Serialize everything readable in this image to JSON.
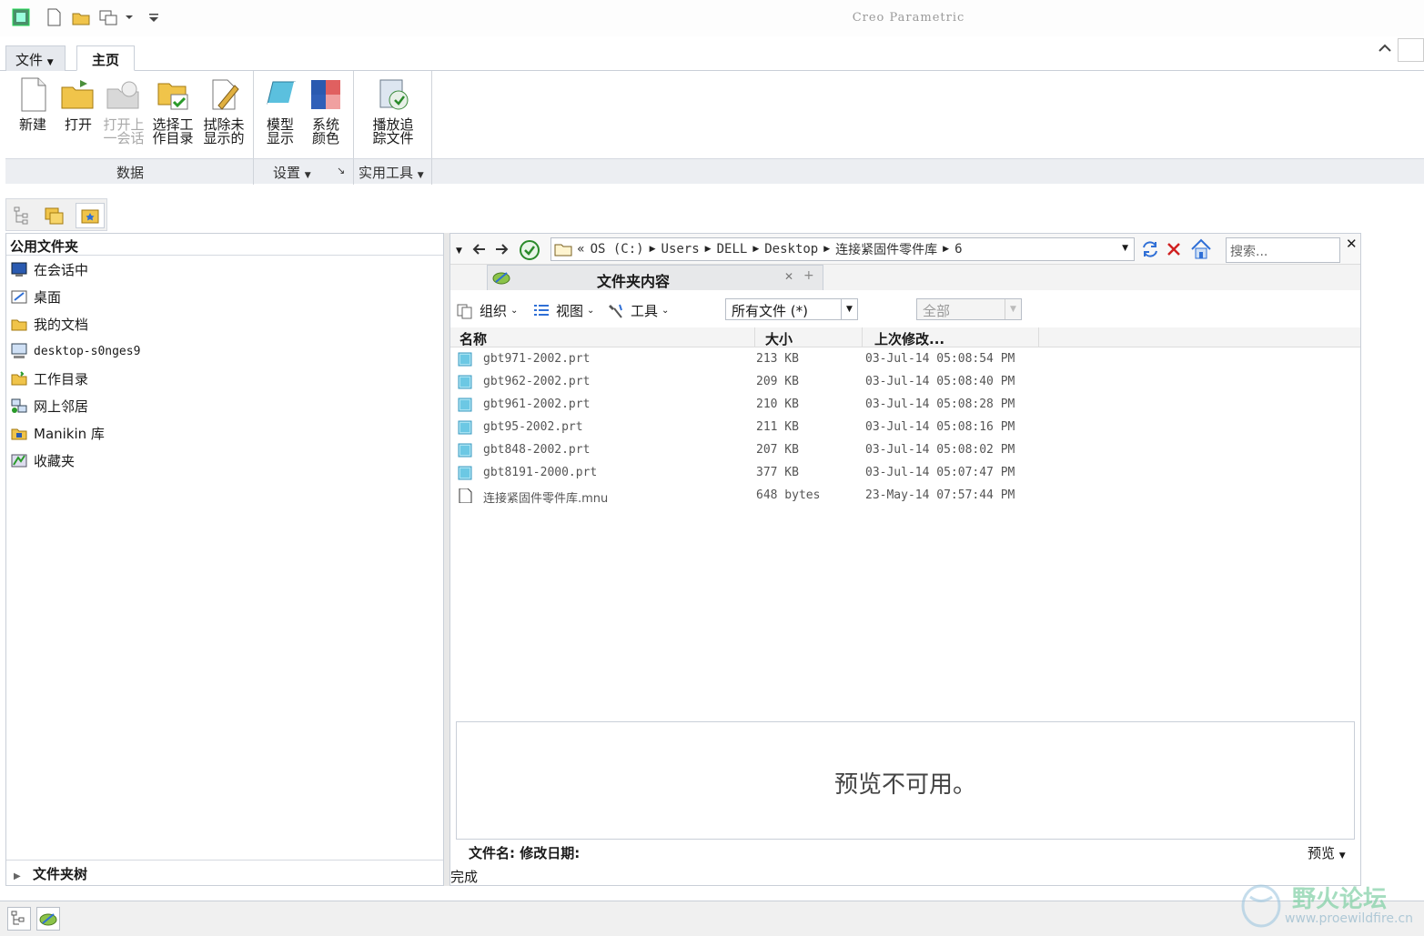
{
  "app": {
    "title": "Creo Parametric"
  },
  "ribbon": {
    "tabs": [
      {
        "label": "文件"
      },
      {
        "label": "主页"
      }
    ],
    "buttons": [
      {
        "label": "新建",
        "enabled": true,
        "icon": "new-file-icon"
      },
      {
        "label": "打开",
        "enabled": true,
        "icon": "open-folder-icon"
      },
      {
        "label1": "打开上",
        "label2": "一会话",
        "enabled": false,
        "icon": "open-last-session-icon"
      },
      {
        "label1": "选择工",
        "label2": "作目录",
        "enabled": true,
        "icon": "select-working-directory-icon"
      },
      {
        "label1": "拭除未",
        "label2": "显示的",
        "enabled": true,
        "icon": "erase-not-displayed-icon"
      },
      {
        "label1": "模型",
        "label2": "显示",
        "enabled": true,
        "icon": "model-display-icon"
      },
      {
        "label1": "系统",
        "label2": "颜色",
        "enabled": true,
        "icon": "system-colors-icon"
      },
      {
        "label1": "播放追",
        "label2": "踪文件",
        "enabled": true,
        "icon": "play-trail-file-icon"
      }
    ],
    "groups": [
      {
        "label": "数据"
      },
      {
        "label": "设置"
      },
      {
        "label": "实用工具"
      }
    ]
  },
  "left_panel": {
    "header": "公用文件夹",
    "items": [
      {
        "label": "在会话中",
        "icon": "in-session-icon"
      },
      {
        "label": "桌面",
        "icon": "desktop-icon"
      },
      {
        "label": "我的文档",
        "icon": "my-documents-icon"
      },
      {
        "label": "desktop-s0nges9",
        "icon": "computer-icon"
      },
      {
        "label": "工作目录",
        "icon": "working-directory-icon"
      },
      {
        "label": "网上邻居",
        "icon": "network-icon"
      },
      {
        "label": "Manikin 库",
        "icon": "manikin-library-icon"
      },
      {
        "label": "收藏夹",
        "icon": "favorites-icon"
      }
    ],
    "footer": "文件夹树"
  },
  "address": {
    "crumbs": [
      "OS (C:)",
      "Users",
      "DELL",
      "Desktop",
      "连接紧固件零件库",
      "6"
    ],
    "prefix": "«",
    "search_placeholder": "搜索..."
  },
  "content": {
    "tab_label": "文件夹内容",
    "toolbar": {
      "organize": "组织",
      "view": "视图",
      "tools": "工具",
      "filter": "所有文件 (*)",
      "scope": "全部"
    },
    "columns": {
      "name": "名称",
      "size": "大小",
      "modified": "上次修改..."
    },
    "files": [
      {
        "name": "gbt971-2002.prt",
        "size": "213 KB",
        "modified": "03-Jul-14 05:08:54 PM",
        "type": "part"
      },
      {
        "name": "gbt962-2002.prt",
        "size": "209 KB",
        "modified": "03-Jul-14 05:08:40 PM",
        "type": "part"
      },
      {
        "name": "gbt961-2002.prt",
        "size": "210 KB",
        "modified": "03-Jul-14 05:08:28 PM",
        "type": "part"
      },
      {
        "name": "gbt95-2002.prt",
        "size": "211 KB",
        "modified": "03-Jul-14 05:08:16 PM",
        "type": "part"
      },
      {
        "name": "gbt848-2002.prt",
        "size": "207 KB",
        "modified": "03-Jul-14 05:08:02 PM",
        "type": "part"
      },
      {
        "name": "gbt8191-2000.prt",
        "size": "377 KB",
        "modified": "03-Jul-14 05:07:47 PM",
        "type": "part"
      },
      {
        "name": "连接紧固件零件库.mnu",
        "size": "648 bytes",
        "modified": "23-May-14 07:57:44 PM",
        "type": "doc"
      }
    ],
    "preview_message": "预览不可用。",
    "meta_line": "文件名: 修改日期:",
    "preview_button": "预览",
    "status": "完成"
  },
  "watermark": {
    "text": "野火论坛",
    "url": "www.proewildfire.cn"
  },
  "colors": {
    "accent": "#2f6fd6",
    "part_icon": "#5bc0de",
    "tab_bg": "#e6e9ee"
  }
}
